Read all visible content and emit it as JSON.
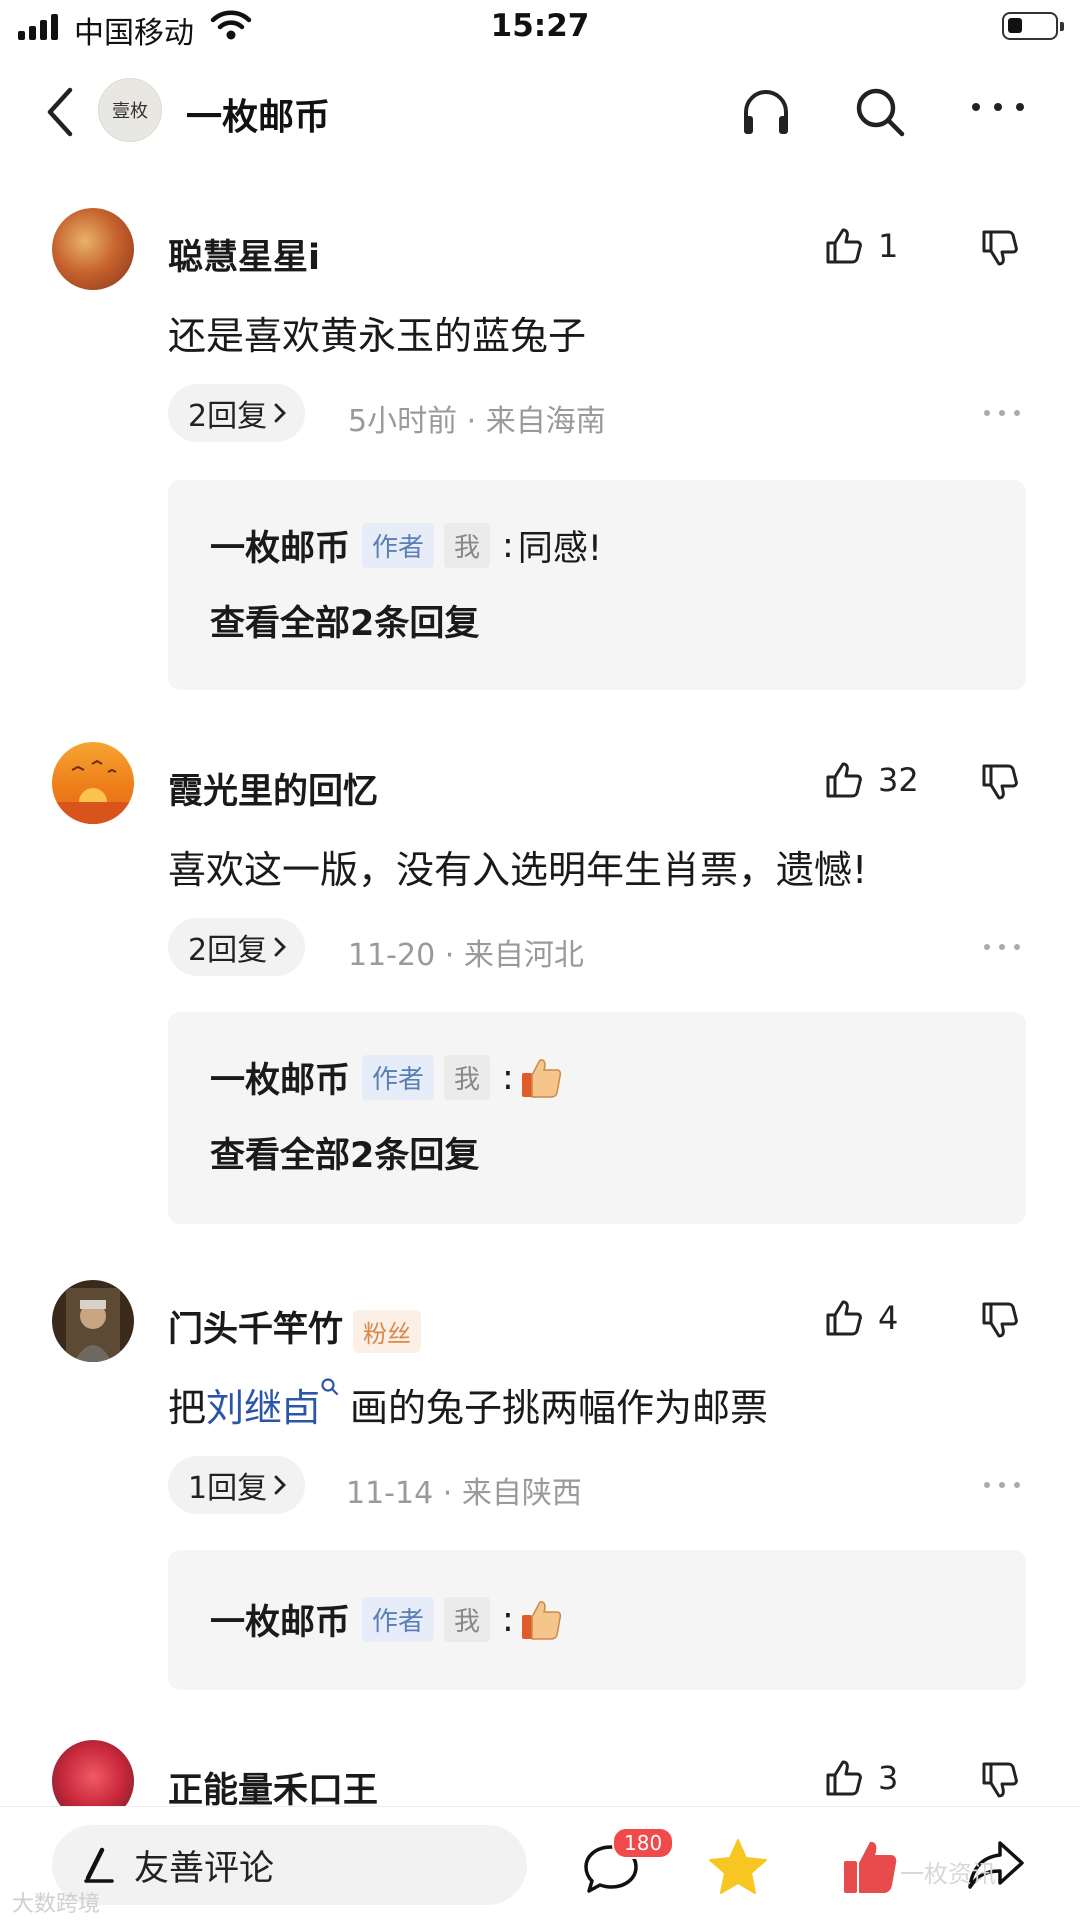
{
  "status_bar": {
    "carrier": "中国移动",
    "time": "15:27"
  },
  "nav": {
    "avatar_text": "壹枚",
    "title": "一枚邮币"
  },
  "comments": [
    {
      "user": "聪慧星星i",
      "badge": "",
      "likes": "1",
      "text": "还是喜欢黄永玉的蓝兔子",
      "text_link": "",
      "text_after": "",
      "reply_count": "2回复",
      "time": "5小时前",
      "location": "来自海南",
      "reply": {
        "name": "一枚邮币",
        "tag_author": "作者",
        "tag_me": "我",
        "colon": ":",
        "content": "同感!",
        "has_thumb_emoji": false
      },
      "view_all": "查看全部2条回复"
    },
    {
      "user": "霞光里的回忆",
      "badge": "",
      "likes": "32",
      "text": "喜欢这一版，没有入选明年生肖票，遗憾!",
      "text_link": "",
      "text_after": "",
      "reply_count": "2回复",
      "time": "11-20",
      "location": "来自河北",
      "reply": {
        "name": "一枚邮币",
        "tag_author": "作者",
        "tag_me": "我",
        "colon": ":",
        "content": "",
        "has_thumb_emoji": true
      },
      "view_all": "查看全部2条回复"
    },
    {
      "user": "门头千竿竹",
      "badge": "粉丝",
      "likes": "4",
      "text": "把",
      "text_link": "刘继卣",
      "text_after": "画的兔子挑两幅作为邮票",
      "reply_count": "1回复",
      "time": "11-14",
      "location": "来自陕西",
      "reply": {
        "name": "一枚邮币",
        "tag_author": "作者",
        "tag_me": "我",
        "colon": ":",
        "content": "",
        "has_thumb_emoji": true
      },
      "view_all": ""
    },
    {
      "user": "正能量禾口王",
      "badge": "",
      "likes": "3"
    }
  ],
  "meta_separator": "·",
  "bottom_bar": {
    "placeholder": "友善评论",
    "comment_badge": "180"
  },
  "watermarks": {
    "left": "大数跨境",
    "right": "一枚资讯"
  },
  "colors": {
    "link": "#2b56a8",
    "author_tag": "#5b7fb5",
    "fan_tag": "#d88a4a",
    "star": "#f7c623",
    "like_active": "#e84b4b",
    "badge": "#f04a4a"
  },
  "icons": [
    "back-icon",
    "headphone-icon",
    "search-icon",
    "more-icon",
    "thumb-up-icon",
    "thumb-down-icon",
    "chevron-right-icon",
    "pen-icon",
    "comment-icon",
    "star-icon",
    "share-icon"
  ]
}
